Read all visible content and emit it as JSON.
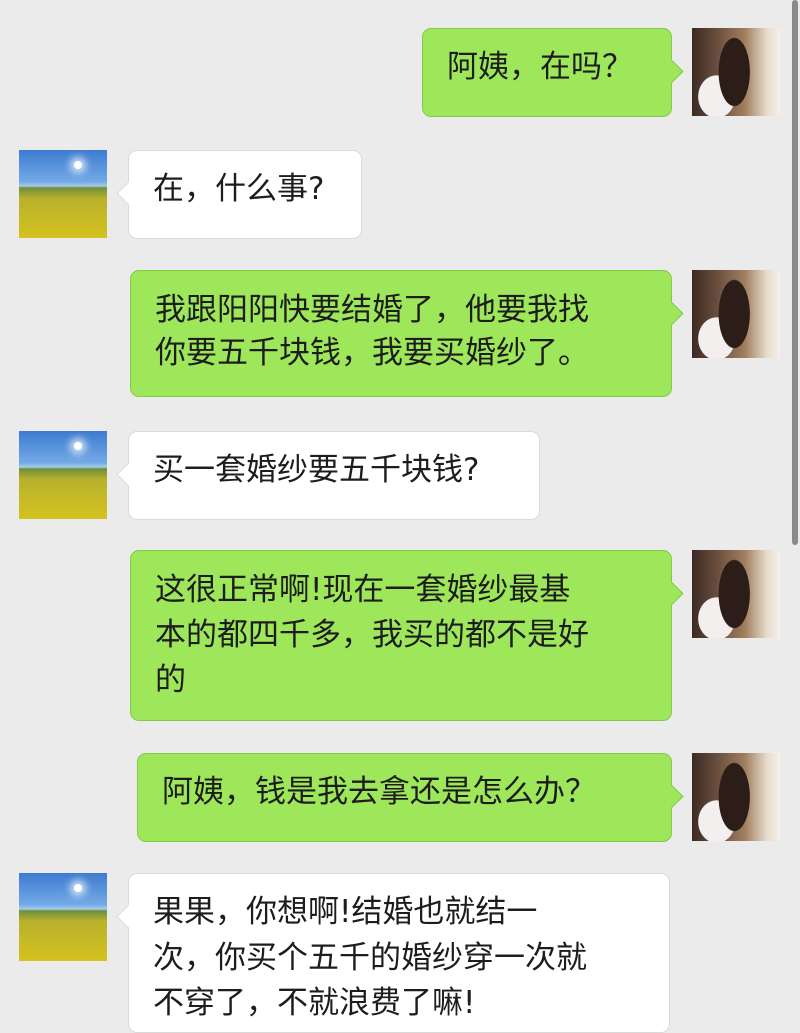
{
  "chat": {
    "messages": [
      {
        "side": "right",
        "lines": [
          "阿姨，在吗？"
        ]
      },
      {
        "side": "left",
        "lines": [
          "在，什么事?"
        ]
      },
      {
        "side": "right",
        "lines": [
          "我跟阳阳快要结婚了，他要我找",
          "你要五千块钱，我要买婚纱了。"
        ]
      },
      {
        "side": "left",
        "lines": [
          "买一套婚纱要五千块钱?"
        ]
      },
      {
        "side": "right",
        "lines": [
          "这很正常啊!现在一套婚纱最基",
          "本的都四千多，我买的都不是好",
          "的"
        ]
      },
      {
        "side": "right",
        "lines": [
          "阿姨，钱是我去拿还是怎么办？"
        ]
      },
      {
        "side": "left",
        "lines": [
          "果果，你想啊!结婚也就结一",
          "次，你买个五千的婚纱穿一次就",
          "不穿了，不就浪费了嘛!"
        ]
      }
    ]
  }
}
